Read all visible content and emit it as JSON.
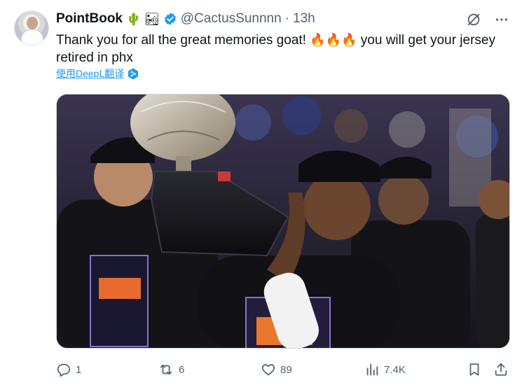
{
  "author": {
    "display_name": "PointBook",
    "name_emojis": [
      "🌵",
      "🏜"
    ],
    "handle": "@CactusSunnnn",
    "separator": "·",
    "time": "13h",
    "verified_color": "#1d9bf0"
  },
  "tweet": {
    "text_part1": "Thank you for all the great memories goat!",
    "emojis": [
      "🔥",
      "🔥",
      "🔥"
    ],
    "text_part2": "you will get your jersey retired in phx",
    "translate_label": "使用DeepL翻译"
  },
  "media": {
    "description_icons": [
      "trophy-image"
    ]
  },
  "actions": {
    "replies": "1",
    "reposts": "6",
    "likes": "89",
    "views": "7.4K"
  },
  "colors": {
    "text": "#0f1419",
    "secondary": "#536471",
    "accent": "#1d9bf0"
  }
}
